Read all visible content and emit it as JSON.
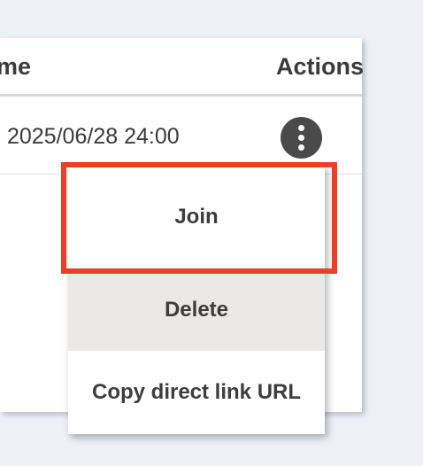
{
  "table": {
    "header_left": "me",
    "header_actions": "Actions",
    "rows": [
      {
        "date": "2025/06/28 24:00"
      }
    ]
  },
  "menu": {
    "join_label": "Join",
    "delete_label": "Delete",
    "copy_label": "Copy direct link URL"
  },
  "icons": {
    "actions_button": "more-vertical-icon"
  },
  "colors": {
    "highlight": "#e8402a",
    "hover_item_bg": "#ebe9e7",
    "page_bg": "#edf1f6"
  }
}
